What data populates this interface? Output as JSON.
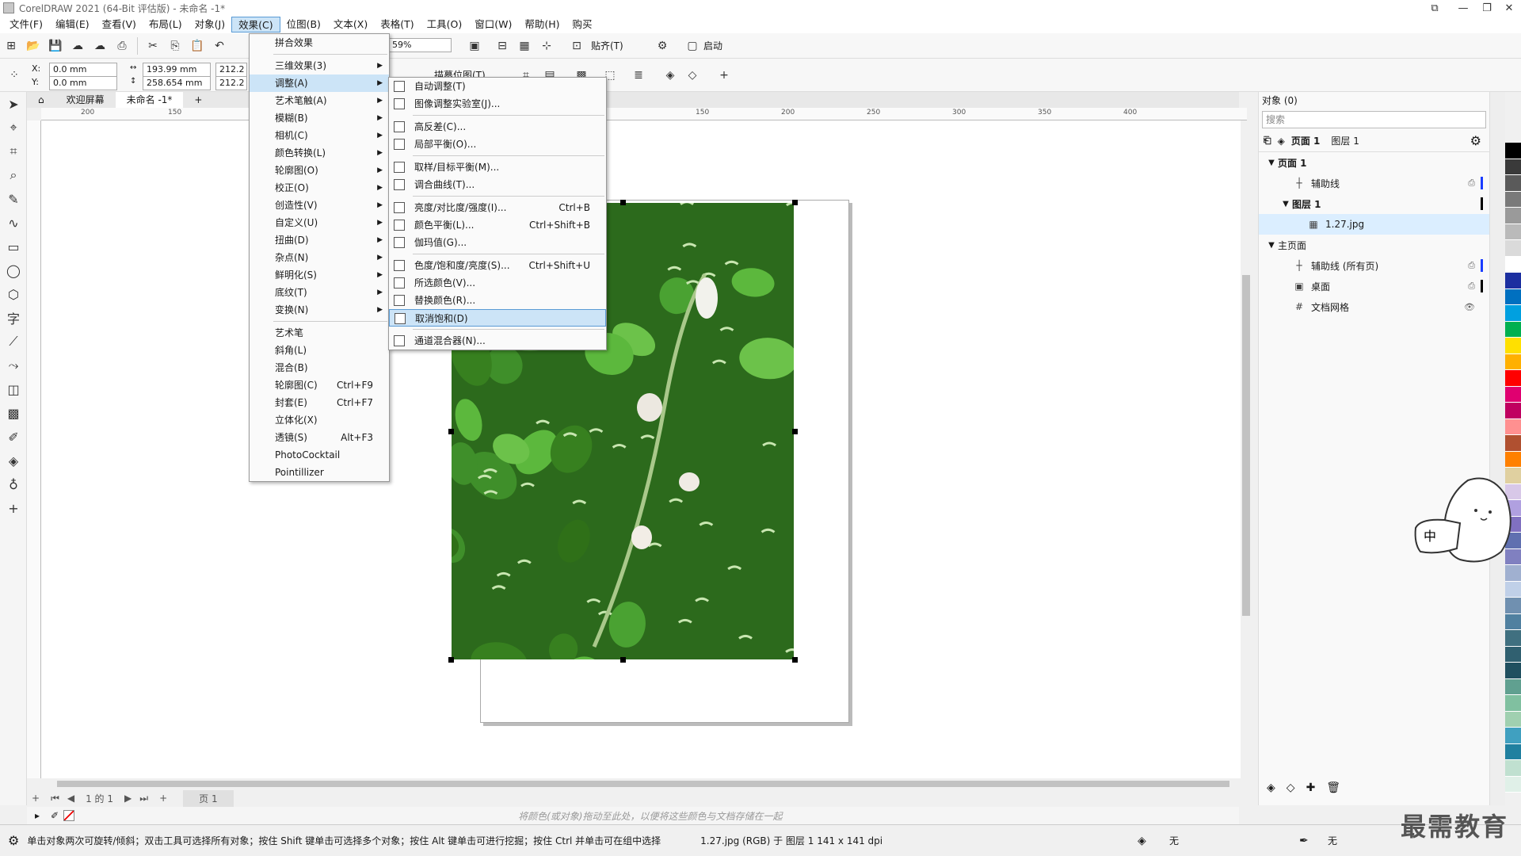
{
  "window": {
    "title": "CorelDRAW 2021 (64-Bit 评估版) - 未命名 -1*"
  },
  "menubar": [
    {
      "label": "文件(F)"
    },
    {
      "label": "编辑(E)"
    },
    {
      "label": "查看(V)"
    },
    {
      "label": "布局(L)"
    },
    {
      "label": "对象(J)"
    },
    {
      "label": "效果(C)",
      "active": true
    },
    {
      "label": "位图(B)"
    },
    {
      "label": "文本(X)"
    },
    {
      "label": "表格(T)"
    },
    {
      "label": "工具(O)"
    },
    {
      "label": "窗口(W)"
    },
    {
      "label": "帮助(H)"
    },
    {
      "label": "购买"
    }
  ],
  "toolbar": {
    "zoom_value": "59%",
    "snap_label": "贴齐(T)",
    "launch_label": "启动",
    "trace_label": "描摹位图(T)"
  },
  "property_bar": {
    "x_label": "X:",
    "x_value": "0.0 mm",
    "y_label": "Y:",
    "y_value": "0.0 mm",
    "width_value": "193.99 mm",
    "height_value": "258.654 mm",
    "scale_w": "212.2",
    "scale_h": "212.2"
  },
  "doc_tabs": {
    "welcome": "欢迎屏幕",
    "document": "未命名 -1*"
  },
  "ruler": {
    "h_ticks": [
      "200",
      "150",
      "150",
      "200",
      "250",
      "300",
      "350",
      "400"
    ]
  },
  "effects_menu": {
    "items": [
      {
        "label": "拼合效果",
        "arrow": false
      },
      {
        "label": "三维效果(3)",
        "arrow": true
      },
      {
        "label": "调整(A)",
        "arrow": true,
        "highlight": true
      },
      {
        "label": "艺术笔触(A)",
        "arrow": true
      },
      {
        "label": "模糊(B)",
        "arrow": true
      },
      {
        "label": "相机(C)",
        "arrow": true
      },
      {
        "label": "颜色转换(L)",
        "arrow": true
      },
      {
        "label": "轮廓图(O)",
        "arrow": true
      },
      {
        "label": "校正(O)",
        "arrow": true
      },
      {
        "label": "创造性(V)",
        "arrow": true
      },
      {
        "label": "自定义(U)",
        "arrow": true
      },
      {
        "label": "扭曲(D)",
        "arrow": true
      },
      {
        "label": "杂点(N)",
        "arrow": true
      },
      {
        "label": "鲜明化(S)",
        "arrow": true
      },
      {
        "label": "底纹(T)",
        "arrow": true
      },
      {
        "label": "变换(N)",
        "arrow": true
      }
    ],
    "items2": [
      {
        "label": "艺术笔",
        "key": ""
      },
      {
        "label": "斜角(L)",
        "key": ""
      },
      {
        "label": "混合(B)",
        "key": ""
      },
      {
        "label": "轮廓图(C)",
        "key": "Ctrl+F9"
      },
      {
        "label": "封套(E)",
        "key": "Ctrl+F7"
      },
      {
        "label": "立体化(X)",
        "key": ""
      },
      {
        "label": "透镜(S)",
        "key": "Alt+F3"
      },
      {
        "label": "PhotoCocktail",
        "key": ""
      },
      {
        "label": "Pointillizer",
        "key": ""
      }
    ]
  },
  "adjust_menu": {
    "group1": [
      {
        "label": "自动调整(T)",
        "key": ""
      },
      {
        "label": "图像调整实验室(J)...",
        "key": ""
      }
    ],
    "group2": [
      {
        "label": "高反差(C)...",
        "key": ""
      },
      {
        "label": "局部平衡(O)...",
        "key": ""
      }
    ],
    "group3": [
      {
        "label": "取样/目标平衡(M)...",
        "key": ""
      },
      {
        "label": "调合曲线(T)...",
        "key": ""
      }
    ],
    "group4": [
      {
        "label": "亮度/对比度/强度(I)...",
        "key": "Ctrl+B"
      },
      {
        "label": "颜色平衡(L)...",
        "key": "Ctrl+Shift+B"
      },
      {
        "label": "伽玛值(G)...",
        "key": ""
      }
    ],
    "group5": [
      {
        "label": "色度/饱和度/亮度(S)...",
        "key": "Ctrl+Shift+U"
      },
      {
        "label": "所选颜色(V)...",
        "key": ""
      },
      {
        "label": "替换颜色(R)...",
        "key": ""
      },
      {
        "label": "取消饱和(D)",
        "key": "",
        "highlight": true
      }
    ],
    "group6": [
      {
        "label": "通道混合器(N)...",
        "key": ""
      }
    ]
  },
  "objects_docker": {
    "title": "对象 (0)",
    "search_placeholder": "搜索",
    "page_label": "页面 1",
    "layer_label": "图层 1",
    "tree": [
      {
        "label": "页面 1",
        "level": 0,
        "expander": "▼",
        "bold": true
      },
      {
        "label": "辅助线",
        "level": 1,
        "icon": "┼",
        "stripe": "#1a3cff",
        "lock": "⎙"
      },
      {
        "label": "图层 1",
        "level": 1,
        "expander": "▼",
        "bold": true,
        "stripe": "#000000"
      },
      {
        "label": "1.27.jpg",
        "level": 2,
        "selected": true,
        "icon": "▦"
      },
      {
        "label": "主页面",
        "level": 0,
        "expander": "▼"
      },
      {
        "label": "辅助线 (所有页)",
        "level": 1,
        "icon": "┼",
        "stripe": "#1a3cff",
        "lock": "⎙"
      },
      {
        "label": "桌面",
        "level": 1,
        "icon": "▣",
        "stripe": "#000000",
        "lock": "⎙"
      },
      {
        "label": "文档网格",
        "level": 1,
        "icon": "#",
        "lock": "👁"
      }
    ]
  },
  "page_nav": {
    "page_counter": "1 的 1",
    "page_tab": "页 1"
  },
  "color_hint": "将颜色(或对象)拖动至此处，以便将这些颜色与文档存储在一起",
  "status": {
    "hint": "单击对象两次可旋转/倾斜；双击工具可选择所有对象；按住 Shift 键单击可选择多个对象；按住 Alt 键单击可进行挖掘；按住 Ctrl 并单击可在组中选择",
    "object_info": "1.27.jpg (RGB) 于 图层 1 141 x 141 dpi",
    "fill_label": "无",
    "outline_label": "无"
  },
  "mascot_text": "中",
  "watermark": "最需教育",
  "palette": [
    "#000000",
    "#3a3a3a",
    "#5a5a5a",
    "#7a7a7a",
    "#9a9a9a",
    "#bababa",
    "#dadada",
    "#ffffff",
    "#1c2fa0",
    "#0070c0",
    "#00a0e0",
    "#00b050",
    "#ffe000",
    "#ffb000",
    "#ff0000",
    "#e00070",
    "#c00060",
    "#ff9090",
    "#b05030",
    "#ff8000",
    "#e0d0a0",
    "#d8c8e8",
    "#b0a0e0",
    "#8070c0",
    "#6070b0",
    "#8080c0",
    "#a0b0d0",
    "#c0d0e8",
    "#7090b0",
    "#5080a0",
    "#407080",
    "#306070",
    "#205060",
    "#60a090",
    "#80c0a0",
    "#a0d0b0",
    "#40a0c0",
    "#2080a0",
    "#c0e0d0",
    "#e0f0e8"
  ]
}
